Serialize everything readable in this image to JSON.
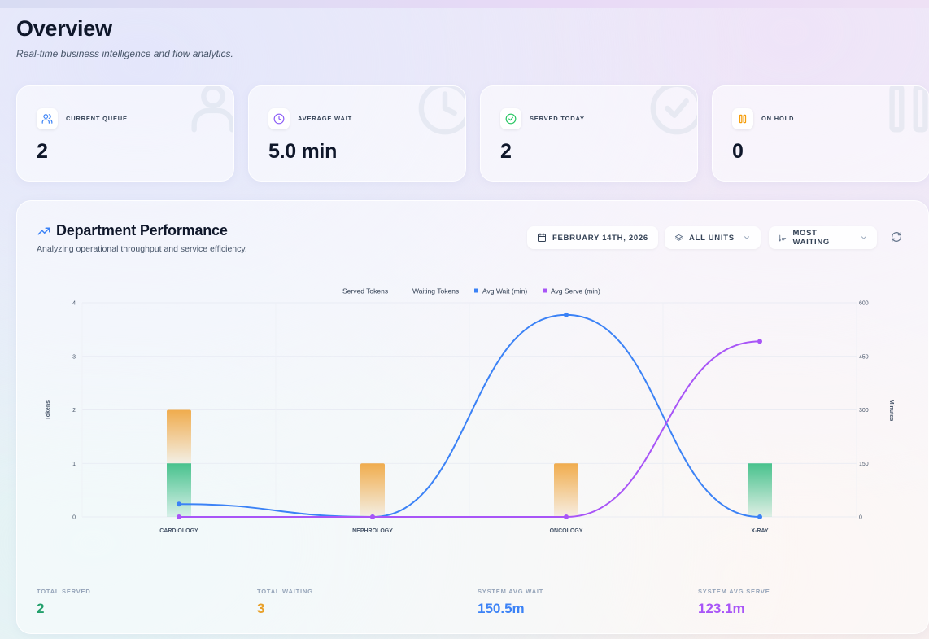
{
  "header": {
    "title": "Overview",
    "subtitle": "Real-time business intelligence and flow analytics."
  },
  "stats": [
    {
      "label": "CURRENT QUEUE",
      "value": "2",
      "icon": "users-icon",
      "color": "#3b82f6"
    },
    {
      "label": "AVERAGE WAIT",
      "value": "5.0 min",
      "icon": "clock-icon",
      "color": "#8b5cf6"
    },
    {
      "label": "SERVED TODAY",
      "value": "2",
      "icon": "check-circle-icon",
      "color": "#22c55e"
    },
    {
      "label": "ON HOLD",
      "value": "0",
      "icon": "pause-icon",
      "color": "#f59e0b"
    }
  ],
  "panel": {
    "title": "Department Performance",
    "subtitle": "Analyzing operational throughput and service efficiency.",
    "date_label": "FEBRUARY 14TH, 2026",
    "unit_filter": "ALL UNITS",
    "sort_filter": "MOST WAITING"
  },
  "colors": {
    "served": "#3fbf87",
    "waiting": "#f0a844",
    "avg_wait": "#3b82f6",
    "avg_serve": "#a855f7"
  },
  "chart_data": {
    "type": "bar",
    "categories": [
      "CARDIOLOGY",
      "NEPHROLOGY",
      "ONCOLOGY",
      "X-RAY"
    ],
    "series": [
      {
        "name": "Served Tokens",
        "type": "bar",
        "axis": "left",
        "values": [
          1,
          0,
          0,
          1
        ]
      },
      {
        "name": "Waiting Tokens",
        "type": "bar",
        "axis": "left",
        "values": [
          1,
          1,
          1,
          0
        ]
      },
      {
        "name": "Avg Wait (min)",
        "type": "line",
        "axis": "right",
        "values": [
          36,
          0,
          566,
          0
        ]
      },
      {
        "name": "Avg Serve (min)",
        "type": "line",
        "axis": "right",
        "values": [
          0,
          0,
          0,
          492
        ]
      }
    ],
    "ylabel": "Tokens",
    "y2label": "Minutes",
    "ylim": [
      0,
      4
    ],
    "y2lim": [
      0,
      600
    ],
    "yticks": [
      "0",
      "1",
      "2",
      "3",
      "4"
    ],
    "y2ticks": [
      "0",
      "150",
      "300",
      "450",
      "600"
    ],
    "grid": true,
    "legend": "top-center"
  },
  "totals": [
    {
      "label": "TOTAL SERVED",
      "value": "2",
      "color": "#22a06b"
    },
    {
      "label": "TOTAL WAITING",
      "value": "3",
      "color": "#e8a029"
    },
    {
      "label": "SYSTEM AVG WAIT",
      "value": "150.5m",
      "color": "#3b82f6"
    },
    {
      "label": "SYSTEM AVG SERVE",
      "value": "123.1m",
      "color": "#a855f7"
    }
  ]
}
